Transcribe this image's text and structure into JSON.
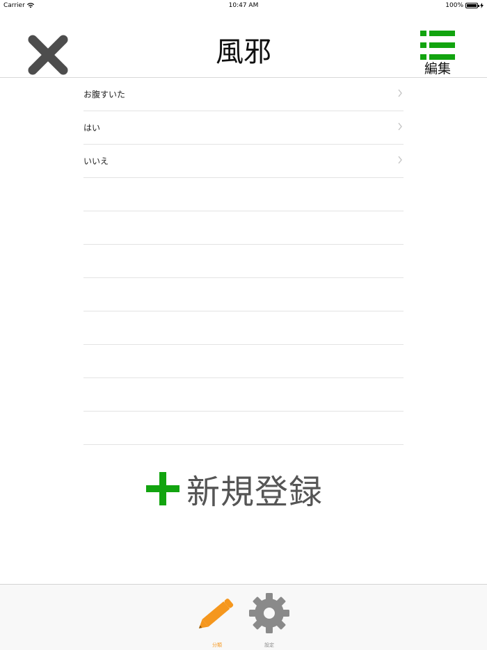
{
  "status_bar": {
    "carrier": "Carrier",
    "time": "10:47 AM",
    "battery": "100%"
  },
  "nav": {
    "title": "風邪",
    "close_icon": "close-x-icon",
    "edit_label": "編集",
    "edit_icon": "list-icon"
  },
  "list": {
    "items": [
      {
        "label": "お腹すいた"
      },
      {
        "label": "はい"
      },
      {
        "label": "いいえ"
      }
    ],
    "empty_rows": 8
  },
  "add_button": {
    "label": "新規登録",
    "icon": "plus-icon"
  },
  "tabs": [
    {
      "label": "分類",
      "icon": "pencil-icon",
      "selected": true
    },
    {
      "label": "設定",
      "icon": "gear-icon",
      "selected": false
    }
  ],
  "colors": {
    "accent_green": "#12a40f",
    "close_gray": "#4d4d4d",
    "tab_selected": "#f5971e",
    "tab_unselected": "#8a8a8a"
  }
}
